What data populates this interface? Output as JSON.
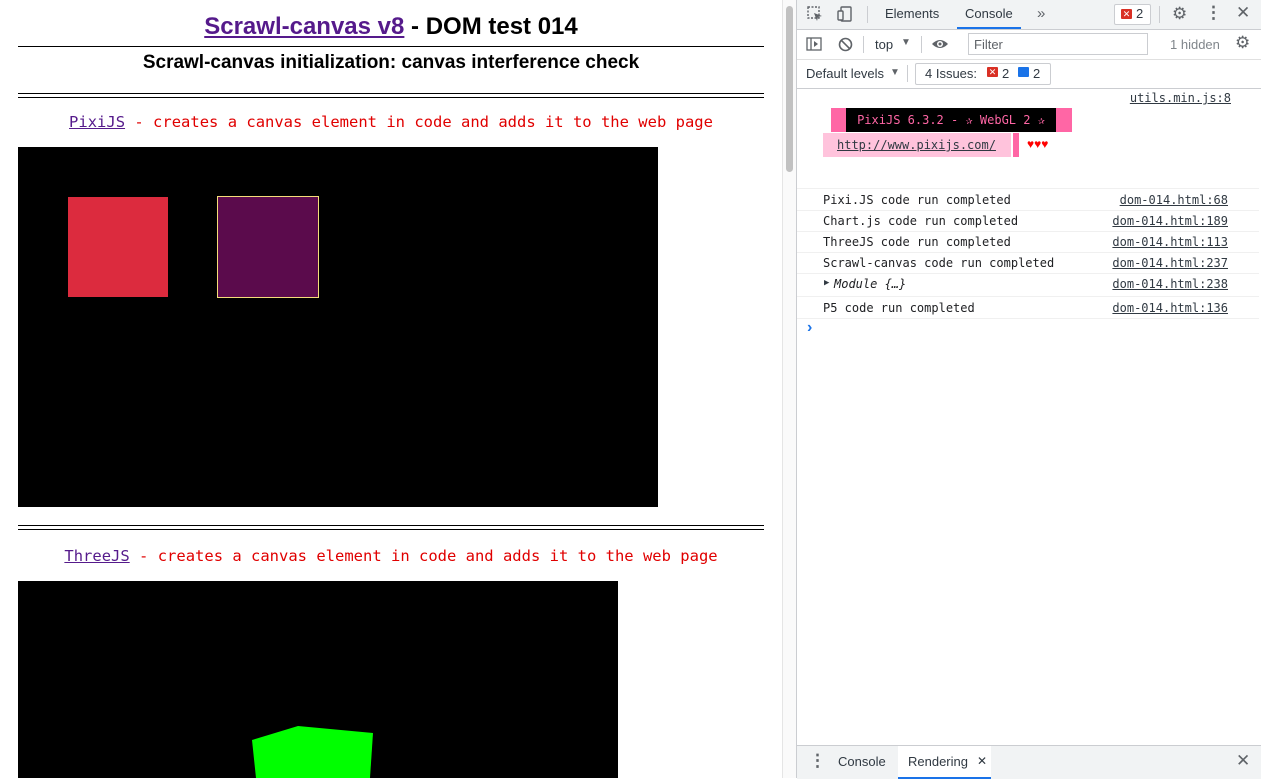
{
  "page": {
    "title_link": "Scrawl-canvas v8",
    "title_rest": " - DOM test 014",
    "subtitle": "Scrawl-canvas initialization: canvas interference check",
    "sections": [
      {
        "link": "PixiJS",
        "text": " - creates a canvas element in code and adds it to the web page"
      },
      {
        "link": "ThreeJS",
        "text": " - creates a canvas element in code and adds it to the web page"
      }
    ],
    "colors": {
      "pixi_red": "#dc2b3e",
      "pixi_purple": "#5b0b4c",
      "three_green": "#00ff00"
    }
  },
  "devtools": {
    "tabs": [
      "Elements",
      "Console"
    ],
    "active_tab": "Console",
    "more_tabs": "»",
    "error_count": "2",
    "context": "top",
    "filter_placeholder": "Filter",
    "hidden": "1 hidden",
    "levels": "Default levels",
    "issues_label": "4 Issues:",
    "issues_errors": "2",
    "issues_messages": "2",
    "pixi_banner": {
      "source": "utils.min.js:8",
      "label": "PixiJS 6.3.2 - ✰ WebGL 2 ✰",
      "url": "http://www.pixijs.com/",
      "hearts": "♥♥♥"
    },
    "logs": [
      {
        "text": "Pixi.JS code run completed",
        "source": "dom-014.html:68"
      },
      {
        "text": "Chart.js code run completed",
        "source": "dom-014.html:189"
      },
      {
        "text": "ThreeJS code run completed",
        "source": "dom-014.html:113"
      },
      {
        "text": "Scrawl-canvas code run completed",
        "source": "dom-014.html:237"
      },
      {
        "text": "Module {…}",
        "source": "dom-014.html:238"
      },
      {
        "text": "P5 code run completed",
        "source": "dom-014.html:136"
      }
    ],
    "prompt": "›",
    "drawer_tabs": [
      "Console",
      "Rendering"
    ],
    "drawer_active": "Rendering"
  }
}
